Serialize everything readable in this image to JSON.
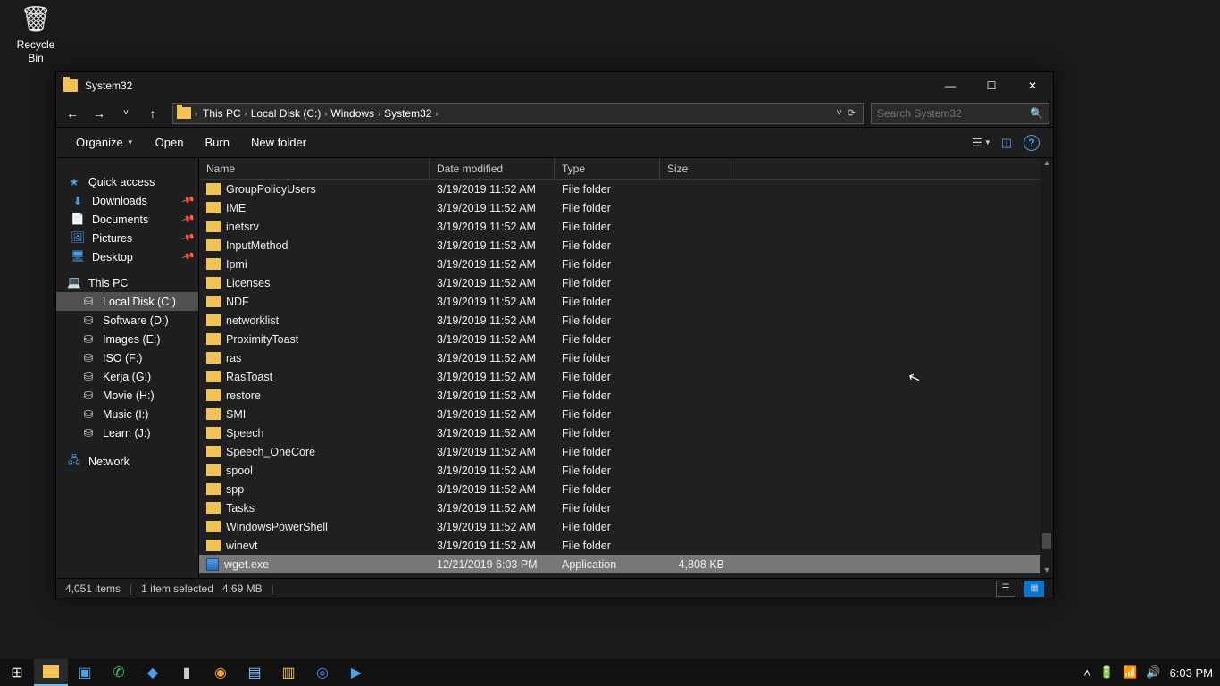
{
  "desktop": {
    "recycle_bin": "Recycle Bin"
  },
  "window": {
    "title": "System32",
    "buttons": {
      "min": "—",
      "max": "☐",
      "close": "✕"
    },
    "breadcrumbs": [
      "This PC",
      "Local Disk (C:)",
      "Windows",
      "System32"
    ],
    "address_suffix": "˅",
    "refresh_icon": "⟳",
    "search_placeholder": "Search System32",
    "toolbar": {
      "organize": "Organize",
      "open": "Open",
      "burn": "Burn",
      "newfolder": "New folder"
    },
    "columns": {
      "name": "Name",
      "date": "Date modified",
      "type": "Type",
      "size": "Size"
    },
    "sidebar": {
      "quick": "Quick access",
      "pinned": [
        "Downloads",
        "Documents",
        "Pictures",
        "Desktop"
      ],
      "thispc": "This PC",
      "drives": [
        "Local Disk (C:)",
        "Software (D:)",
        "Images (E:)",
        "ISO (F:)",
        "Kerja (G:)",
        "Movie (H:)",
        "Music (I:)",
        "Learn (J:)"
      ],
      "network": "Network"
    },
    "files": [
      {
        "name": "GroupPolicyUsers",
        "date": "3/19/2019 11:52 AM",
        "type": "File folder",
        "size": "",
        "kind": "folder"
      },
      {
        "name": "IME",
        "date": "3/19/2019 11:52 AM",
        "type": "File folder",
        "size": "",
        "kind": "folder"
      },
      {
        "name": "inetsrv",
        "date": "3/19/2019 11:52 AM",
        "type": "File folder",
        "size": "",
        "kind": "folder"
      },
      {
        "name": "InputMethod",
        "date": "3/19/2019 11:52 AM",
        "type": "File folder",
        "size": "",
        "kind": "folder"
      },
      {
        "name": "Ipmi",
        "date": "3/19/2019 11:52 AM",
        "type": "File folder",
        "size": "",
        "kind": "folder"
      },
      {
        "name": "Licenses",
        "date": "3/19/2019 11:52 AM",
        "type": "File folder",
        "size": "",
        "kind": "folder"
      },
      {
        "name": "NDF",
        "date": "3/19/2019 11:52 AM",
        "type": "File folder",
        "size": "",
        "kind": "folder"
      },
      {
        "name": "networklist",
        "date": "3/19/2019 11:52 AM",
        "type": "File folder",
        "size": "",
        "kind": "folder"
      },
      {
        "name": "ProximityToast",
        "date": "3/19/2019 11:52 AM",
        "type": "File folder",
        "size": "",
        "kind": "folder"
      },
      {
        "name": "ras",
        "date": "3/19/2019 11:52 AM",
        "type": "File folder",
        "size": "",
        "kind": "folder"
      },
      {
        "name": "RasToast",
        "date": "3/19/2019 11:52 AM",
        "type": "File folder",
        "size": "",
        "kind": "folder"
      },
      {
        "name": "restore",
        "date": "3/19/2019 11:52 AM",
        "type": "File folder",
        "size": "",
        "kind": "folder"
      },
      {
        "name": "SMI",
        "date": "3/19/2019 11:52 AM",
        "type": "File folder",
        "size": "",
        "kind": "folder"
      },
      {
        "name": "Speech",
        "date": "3/19/2019 11:52 AM",
        "type": "File folder",
        "size": "",
        "kind": "folder"
      },
      {
        "name": "Speech_OneCore",
        "date": "3/19/2019 11:52 AM",
        "type": "File folder",
        "size": "",
        "kind": "folder"
      },
      {
        "name": "spool",
        "date": "3/19/2019 11:52 AM",
        "type": "File folder",
        "size": "",
        "kind": "folder"
      },
      {
        "name": "spp",
        "date": "3/19/2019 11:52 AM",
        "type": "File folder",
        "size": "",
        "kind": "folder"
      },
      {
        "name": "Tasks",
        "date": "3/19/2019 11:52 AM",
        "type": "File folder",
        "size": "",
        "kind": "folder"
      },
      {
        "name": "WindowsPowerShell",
        "date": "3/19/2019 11:52 AM",
        "type": "File folder",
        "size": "",
        "kind": "folder"
      },
      {
        "name": "winevt",
        "date": "3/19/2019 11:52 AM",
        "type": "File folder",
        "size": "",
        "kind": "folder"
      },
      {
        "name": "wget.exe",
        "date": "12/21/2019 6:03 PM",
        "type": "Application",
        "size": "4,808 KB",
        "kind": "exe",
        "selected": true
      }
    ],
    "status": {
      "count": "4,051 items",
      "selected": "1 item selected",
      "size": "4.69 MB"
    }
  },
  "taskbar": {
    "clock": "6:03 PM"
  }
}
